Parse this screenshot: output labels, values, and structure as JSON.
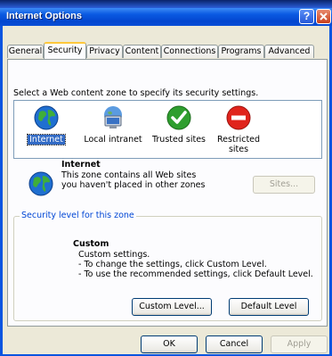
{
  "window": {
    "title": "Internet Options",
    "help_button": "?"
  },
  "tabs": [
    "General",
    "Security",
    "Privacy",
    "Content",
    "Connections",
    "Programs",
    "Advanced"
  ],
  "active_tab": "Security",
  "security": {
    "instruction": "Select a Web content zone to specify its security settings.",
    "zones": [
      {
        "label": "Internet",
        "icon": "globe-icon"
      },
      {
        "label": "Local intranet",
        "icon": "intranet-computer-icon"
      },
      {
        "label": "Trusted sites",
        "icon": "checkmark-icon"
      },
      {
        "label": "Restricted sites",
        "icon": "no-entry-icon"
      }
    ],
    "selected_zone": "Internet",
    "zone_info": {
      "title": "Internet",
      "description": "This zone contains all Web sites you haven't placed in other zones"
    },
    "sites_button": "Sites...",
    "security_level": {
      "legend": "Security level for this zone",
      "level_title": "Custom",
      "lines": [
        "Custom settings.",
        "- To change the settings, click Custom Level.",
        "- To use the recommended settings, click Default Level."
      ],
      "custom_level_button": "Custom Level...",
      "default_level_button": "Default Level"
    }
  },
  "buttons": {
    "ok": "OK",
    "cancel": "Cancel",
    "apply": "Apply"
  },
  "colors": {
    "titlebar": "#0a5ae2",
    "active_tab_accent": "#ffc83c",
    "selection": "#316ac5",
    "legend_text": "#0046d5"
  }
}
